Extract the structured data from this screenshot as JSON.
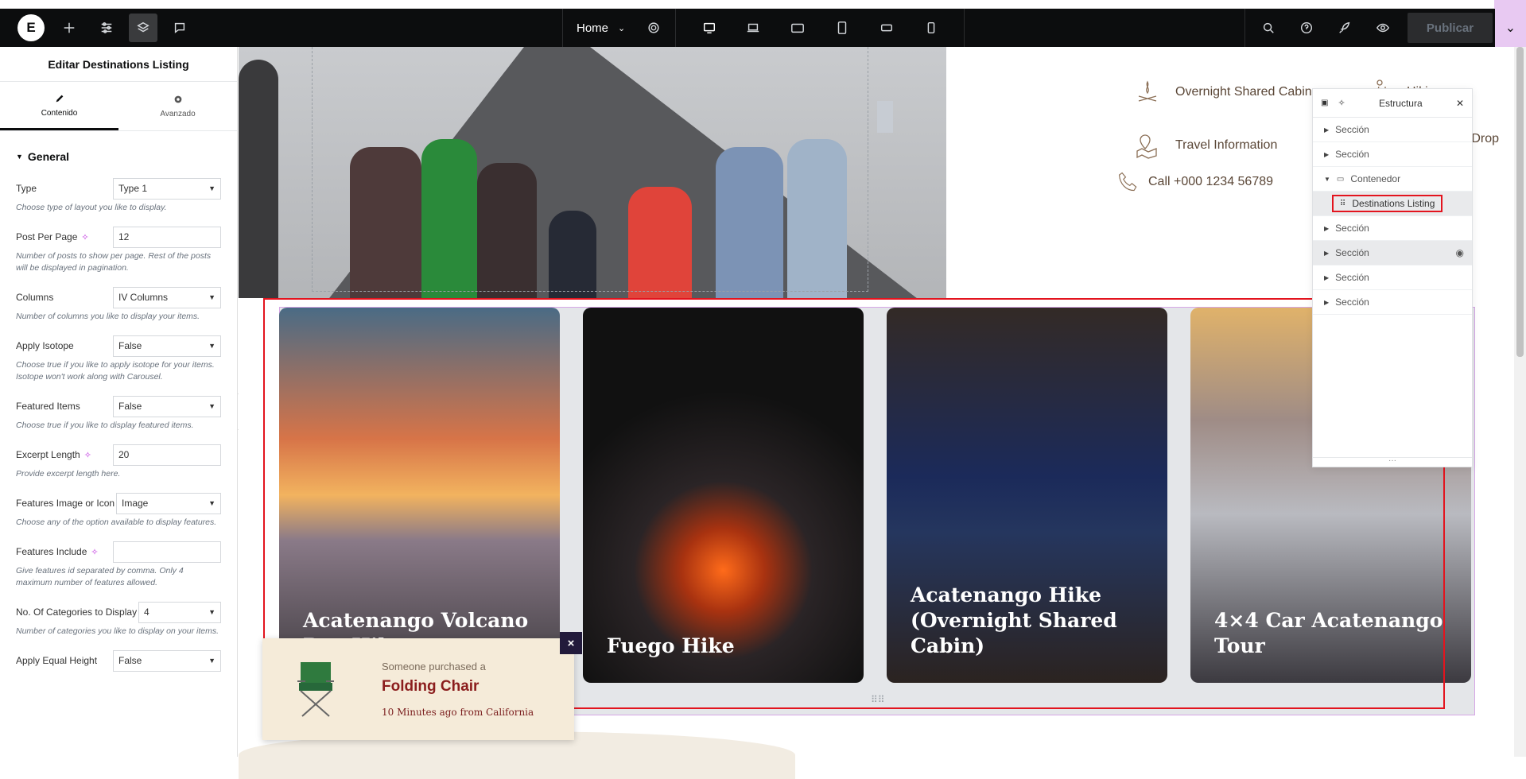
{
  "topbar": {
    "logo": "E",
    "page_name": "Home",
    "publish_label": "Publicar",
    "icons": [
      "plus-icon",
      "sliders-icon",
      "layers-icon",
      "chat-icon",
      "gear-icon",
      "desktop-icon",
      "laptop-icon",
      "tablet-landscape-icon",
      "tablet-icon",
      "mobile-landscape-icon",
      "mobile-icon",
      "search-icon",
      "help-icon",
      "rocket-icon",
      "eye-icon",
      "chevron-down-icon"
    ]
  },
  "panel": {
    "title": "Editar Destinations Listing",
    "tabs": [
      {
        "label": "Contenido"
      },
      {
        "label": "Avanzado"
      }
    ],
    "section": "General",
    "controls": [
      {
        "label": "Type",
        "value": "Type 1",
        "kind": "select",
        "desc": "Choose type of layout you like to display."
      },
      {
        "label": "Post Per Page",
        "value": "12",
        "kind": "input",
        "ai": true,
        "desc": "Number of posts to show per page. Rest of the posts will be displayed in pagination."
      },
      {
        "label": "Columns",
        "value": "IV Columns",
        "kind": "select",
        "desc": "Number of columns you like to display your items."
      },
      {
        "label": "Apply Isotope",
        "value": "False",
        "kind": "select",
        "desc": "Choose true if you like to apply isotope for your items. Isotope won't work along with Carousel."
      },
      {
        "label": "Featured Items",
        "value": "False",
        "kind": "select",
        "desc": "Choose true if you like to display featured items."
      },
      {
        "label": "Excerpt Length",
        "value": "20",
        "kind": "input",
        "ai": true,
        "desc": "Provide excerpt length here."
      },
      {
        "label": "Features Image or Icon",
        "value": "Image",
        "kind": "select",
        "desc": "Choose any of the option available to display features."
      },
      {
        "label": "Features Include",
        "value": "",
        "kind": "input",
        "ai": true,
        "desc": "Give features id separated by comma. Only 4 maximum number of features allowed."
      },
      {
        "label": "No. Of Categories to Display",
        "value": "4",
        "kind": "select",
        "desc": "Number of categories you like to display on your items."
      },
      {
        "label": "Apply Equal Height",
        "value": "False",
        "kind": "select",
        "desc": ""
      }
    ]
  },
  "features": [
    {
      "label": "Overnight Shared Cabin",
      "icon": "campfire-icon"
    },
    {
      "label": "Hiking",
      "icon": "hiker-icon"
    },
    {
      "label": "Travel Information",
      "icon": "map-pin-icon"
    },
    {
      "label": "Pickup And Drop 4X4",
      "icon": "car-icon"
    }
  ],
  "call": {
    "label": "Call +000 1234 56789",
    "icon": "phone-icon"
  },
  "cards": [
    {
      "title": "Acatenango Volcano Day Hike"
    },
    {
      "title": "Fuego Hike"
    },
    {
      "title": "Acatenango Hike (Overnight Shared Cabin)"
    },
    {
      "title": "4×4 Car Acatenango Tour"
    }
  ],
  "popup": {
    "line1": "Someone purchased a",
    "product": "Folding Chair",
    "line3": "10 Minutes ago from California",
    "close": "×"
  },
  "navigator": {
    "title": "Estructura",
    "items": [
      {
        "label": "Sección"
      },
      {
        "label": "Sección"
      },
      {
        "label": "Contenedor"
      },
      {
        "label": "Destinations Listing"
      },
      {
        "label": "Sección"
      },
      {
        "label": "Sección"
      },
      {
        "label": "Sección"
      },
      {
        "label": "Sección"
      }
    ]
  },
  "colors": {
    "accent_red": "#e3141e",
    "topbar_bg": "#0c0d0e",
    "pink": "#e8c9f2",
    "brown_text": "#5a4636"
  }
}
